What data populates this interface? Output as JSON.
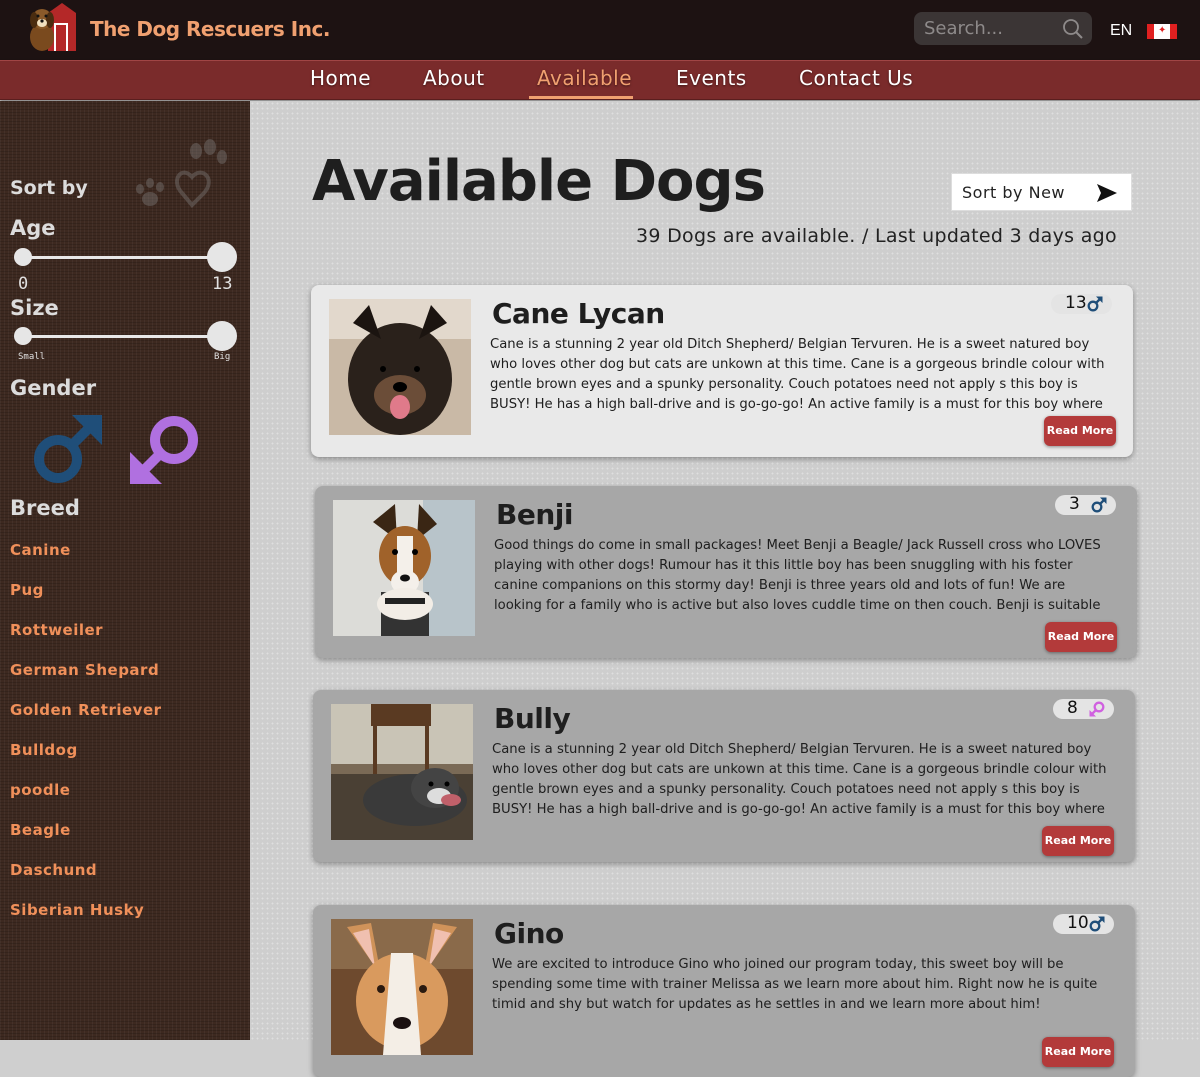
{
  "header": {
    "brand": "The Dog Rescuers Inc.",
    "search_placeholder": "Search...",
    "language": "EN",
    "flag": "canada-flag-icon"
  },
  "nav": {
    "items": [
      {
        "label": "Home",
        "active": false
      },
      {
        "label": "About",
        "active": false
      },
      {
        "label": "Available",
        "active": true
      },
      {
        "label": "Events",
        "active": false
      },
      {
        "label": "Contact Us",
        "active": false
      }
    ]
  },
  "sidebar": {
    "sort_by": "Sort by",
    "age": {
      "label": "Age",
      "min": "0",
      "max": "13"
    },
    "size": {
      "label": "Size",
      "min": "Small",
      "max": "Big"
    },
    "gender": {
      "label": "Gender",
      "male_icon": "male-icon",
      "female_icon": "female-icon"
    },
    "breed": {
      "label": "Breed",
      "items": [
        "Canine",
        "Pug",
        "Rottweiler",
        "German Shepard",
        "Golden Retriever",
        "Bulldog",
        "poodle",
        "Beagle",
        "Daschund",
        "Siberian Husky"
      ]
    }
  },
  "main": {
    "title": "Available Dogs",
    "sort_button": "Sort by New",
    "subtitle": "39 Dogs are available. / Last updated 3 days ago",
    "dogs": [
      {
        "name": "Cane Lycan",
        "age": "13",
        "gender": "male",
        "description": "Cane is a stunning 2 year old Ditch Shepherd/ Belgian Tervuren. He is a sweet natured boy who loves other dog but cats are unkown at this time. Cane is a gorgeous brindle colour with gentle brown eyes and a spunky personality. Couch potatoes need not apply s this boy is BUSY! He has a high ball-drive and is go-go-go! An active family is a must for this boy where all members of the",
        "read_more": "Read More"
      },
      {
        "name": "Benji",
        "age": "3",
        "gender": "male",
        "description": "Good things do come in small packages! Meet Benji a Beagle/ Jack Russell cross who LOVES playing with other dogs! Rumour has it this little boy has been snuggling with his foster canine companions on this stormy day! Benji is three years old and lots of fun! We are looking for a family who is active but also loves cuddle time on then couch. Benji is suitable for a family with",
        "read_more": "Read More"
      },
      {
        "name": "Bully",
        "age": "8",
        "gender": "female",
        "description": "Cane is a stunning 2 year old Ditch Shepherd/ Belgian Tervuren. He is a sweet natured boy who loves other dog but cats are unkown at this time. Cane is a gorgeous brindle colour with gentle brown eyes and a spunky personality. Couch potatoes need not apply s this boy is BUSY! He has a high ball-drive and is go-go-go! An active family is a must for this boy where all members of the",
        "read_more": "Read More"
      },
      {
        "name": "Gino",
        "age": "10",
        "gender": "male",
        "description": "We are excited to introduce Gino who joined our program today, this sweet boy will be spending some time with trainer Melissa  as we learn more about him. Right now he is quite timid and shy but watch for updates as he settles in and we learn more about him!",
        "read_more": "Read More"
      }
    ]
  },
  "colors": {
    "accent": "#f0a070",
    "nav_bg": "#7a2b2b",
    "male": "#1f4e79",
    "female": "#b070e0",
    "read_more": "#b33a3a"
  }
}
